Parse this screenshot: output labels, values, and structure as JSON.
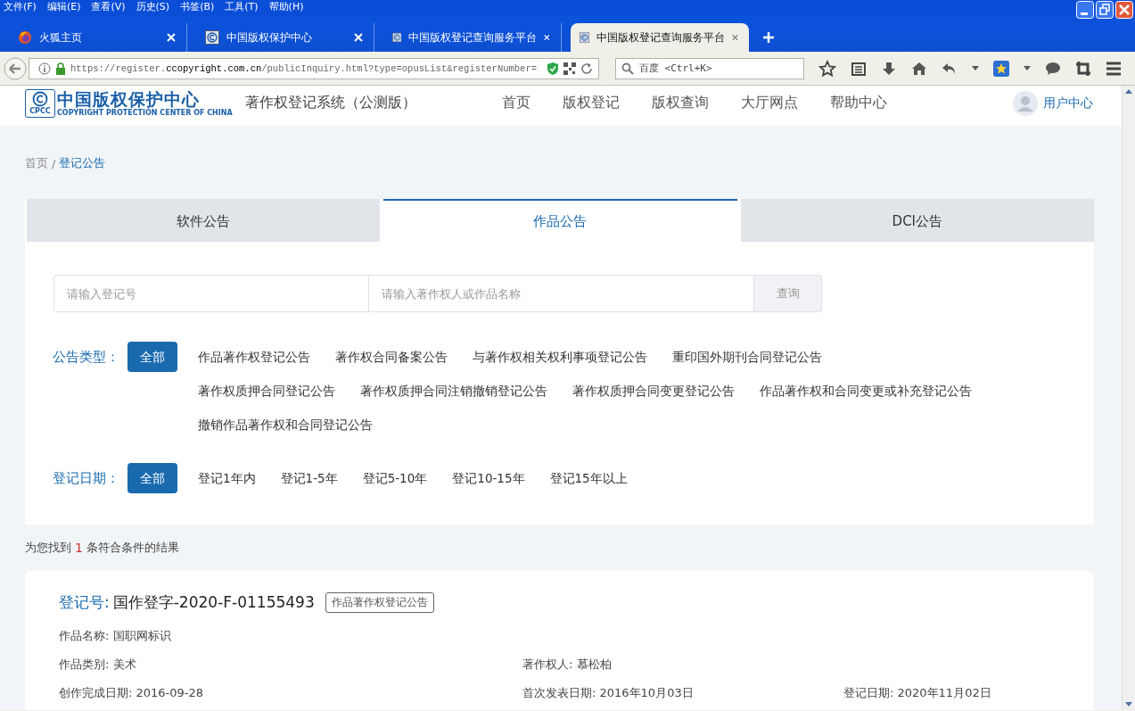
{
  "menu_bar": [
    "文件(F)",
    "编辑(E)",
    "查看(V)",
    "历史(S)",
    "书签(B)",
    "工具(T)",
    "帮助(H)"
  ],
  "browser_tabs": [
    {
      "label": "火狐主页",
      "kind": "firefox",
      "selected": false
    },
    {
      "label": "中国版权保护中心",
      "kind": "site",
      "selected": false
    },
    {
      "label": "中国版权登记查询服务平台",
      "kind": "site",
      "selected": false
    },
    {
      "label": "中国版权登记查询服务平台",
      "kind": "site",
      "selected": true
    }
  ],
  "address_bar": {
    "url": "https://register.**ccopyright.com.cn**/publicInquiry.html?type=opusList&registerNumber="
  },
  "browser_search": {
    "placeholder": "百度 <Ctrl+K>"
  },
  "site_header": {
    "logo_text": "中国版权保护中心",
    "logo_subtext": "COPYRIGHT PROTECTION CENTER OF CHINA",
    "logo_badge": "CPCC",
    "system_title": "著作权登记系统（公测版）",
    "nav": [
      "首页",
      "版权登记",
      "版权查询",
      "大厅网点",
      "帮助中心"
    ],
    "user_link": "用户中心"
  },
  "breadcrumb": {
    "separator": "/",
    "items": [
      {
        "label": "首页",
        "selected": false
      },
      {
        "label": "登记公告",
        "selected": true
      }
    ]
  },
  "category_tabs": [
    {
      "label": "软件公告",
      "selected": false
    },
    {
      "label": "作品公告",
      "selected": true
    },
    {
      "label": "DCI公告",
      "selected": false
    }
  ],
  "search": {
    "number_placeholder": "请输入登记号",
    "name_placeholder": "请输入著作权人或作品名称",
    "button": "查询"
  },
  "filters": [
    {
      "label": "公告类型：",
      "options": [
        {
          "label": "全部",
          "selected": true
        },
        {
          "label": "作品著作权登记公告",
          "selected": false
        },
        {
          "label": "著作权合同备案公告",
          "selected": false
        },
        {
          "label": "与著作权相关权利事项登记公告",
          "selected": false
        },
        {
          "label": "重印国外期刊合同登记公告",
          "selected": false
        },
        {
          "label": "著作权质押合同登记公告",
          "selected": false
        },
        {
          "label": "著作权质押合同注销撤销登记公告",
          "selected": false
        },
        {
          "label": "著作权质押合同变更登记公告",
          "selected": false
        },
        {
          "label": "作品著作权和合同变更或补充登记公告",
          "selected": false
        },
        {
          "label": "撤销作品著作权和合同登记公告",
          "selected": false
        }
      ]
    },
    {
      "label": "登记日期：",
      "options": [
        {
          "label": "全部",
          "selected": true
        },
        {
          "label": "登记1年内",
          "selected": false
        },
        {
          "label": "登记1-5年",
          "selected": false
        },
        {
          "label": "登记5-10年",
          "selected": false
        },
        {
          "label": "登记10-15年",
          "selected": false
        },
        {
          "label": "登记15年以上",
          "selected": false
        }
      ]
    }
  ],
  "result_summary": {
    "prefix": "为您找到",
    "count": "1",
    "suffix": "条符合条件的结果"
  },
  "results": [
    {
      "number_label": "登记号:",
      "number": "国作登字-2020-F-01155493",
      "tag": "作品著作权登记公告",
      "rows": [
        [
          {
            "label": "作品名称:",
            "value": "国职网标识"
          }
        ],
        [
          {
            "label": "作品类别:",
            "value": "美术"
          },
          {
            "label": "著作权人:",
            "value": "慕松柏"
          }
        ],
        [
          {
            "label": "创作完成日期:",
            "value": "2016-09-28"
          },
          {
            "label": "首次发表日期:",
            "value": "2016年10月03日"
          },
          {
            "label": "登记日期:",
            "value": "2020年11月02日"
          }
        ]
      ]
    }
  ]
}
